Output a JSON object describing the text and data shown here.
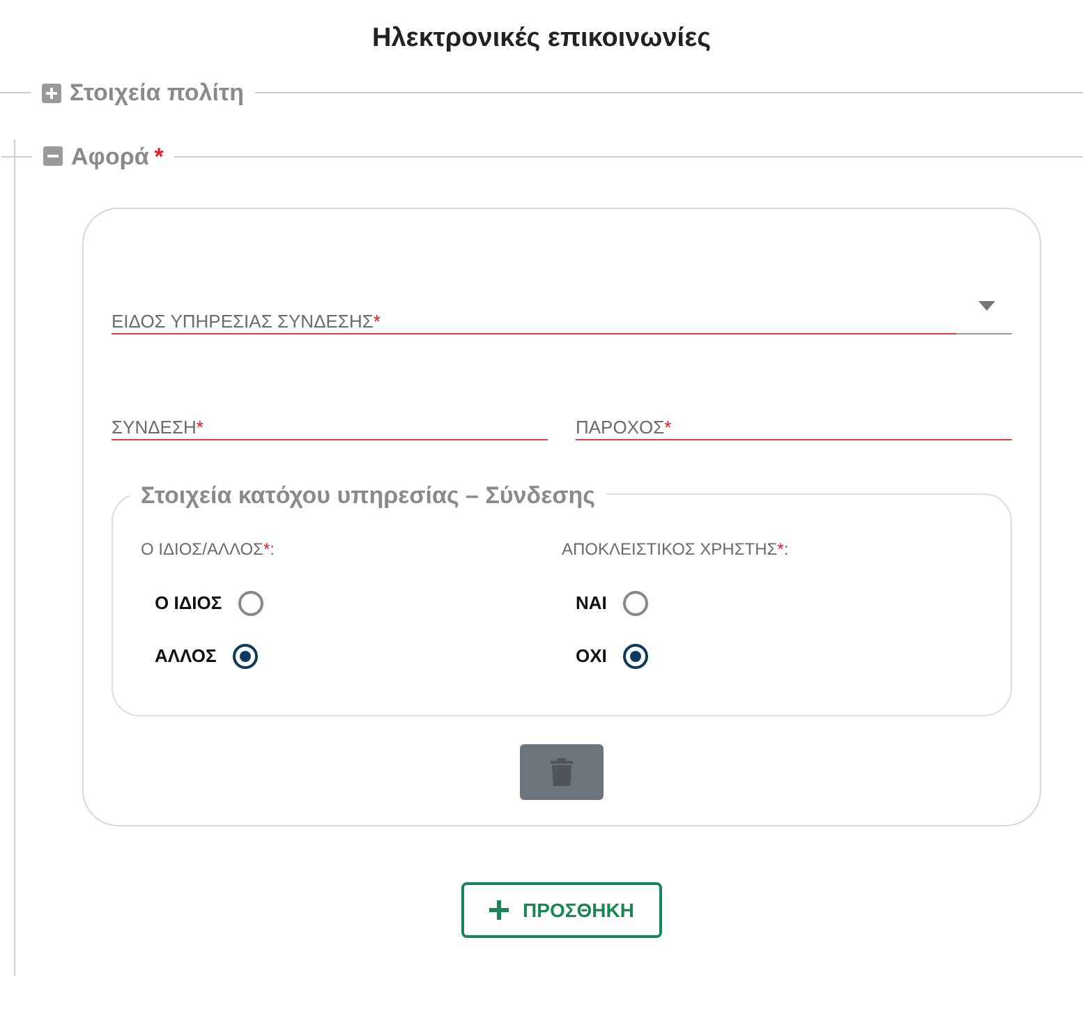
{
  "title": "Ηλεκτρονικές επικοινωνίες",
  "sections": [
    {
      "label": "Στοιχεία πολίτη",
      "expanded": false
    },
    {
      "label": "Αφορά",
      "mark": "*",
      "expanded": true
    }
  ],
  "card": {
    "select": {
      "label": "ΕΙΔΟΣ ΥΠΗΡΕΣΙΑΣ ΣΥΝΔΕΣΗΣ",
      "mark": "*",
      "invalid": true
    },
    "fields": [
      {
        "label": "ΣΥΝΔΕΣΗ",
        "mark": "*",
        "invalid": true
      },
      {
        "label": "ΠΑΡΟΧΟΣ",
        "mark": "*",
        "invalid": true
      }
    ],
    "group": {
      "legend": "Στοιχεία κατόχου υπηρεσίας – Σύνδεσης",
      "radio_groups": [
        {
          "label": "Ο ΙΔΙΟΣ/ΑΛΛΟΣ",
          "mark": "*",
          "suffix": ":",
          "options": [
            {
              "label": "Ο ΙΔΙΟΣ",
              "selected": false
            },
            {
              "label": "ΑΛΛΟΣ",
              "selected": true
            }
          ]
        },
        {
          "label": "ΑΠΟΚΛΕΙΣΤΙΚΟΣ ΧΡΗΣΤΗΣ",
          "mark": "*",
          "suffix": ":",
          "options": [
            {
              "label": "ΝΑΙ",
              "selected": false
            },
            {
              "label": "ΟΧΙ",
              "selected": true
            }
          ]
        }
      ]
    }
  },
  "add_button": {
    "label": "ΠΡΟΣΘΗΚΗ"
  }
}
